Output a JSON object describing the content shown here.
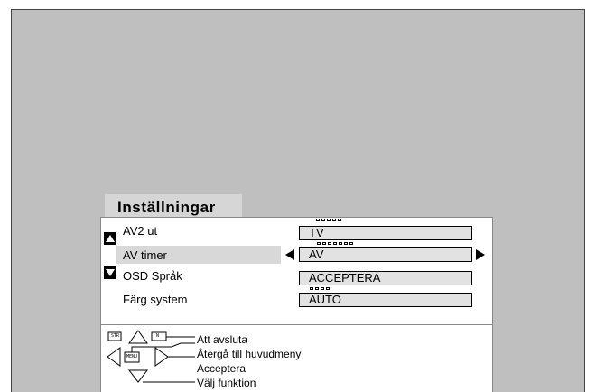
{
  "menu": {
    "title": "Inställningar",
    "rows": [
      {
        "label": "AV2 ut",
        "value": "TV"
      },
      {
        "label": "AV timer",
        "value": "AV"
      },
      {
        "label": "OSD Språk",
        "value": "ACCEPTERA"
      },
      {
        "label": "Färg system",
        "value": "AUTO"
      }
    ],
    "selected_index": 1
  },
  "legend": {
    "str_key": "STR",
    "n_key": "N",
    "menu_key": "MENU",
    "exit": "Att avsluta",
    "back": "Återgå till huvudmeny",
    "accept": "Acceptera",
    "select": "Välj funktion"
  },
  "colors": {
    "screen": "#bfbfbf",
    "highlight": "#d8d8d8",
    "box": "#e2e2e2"
  }
}
